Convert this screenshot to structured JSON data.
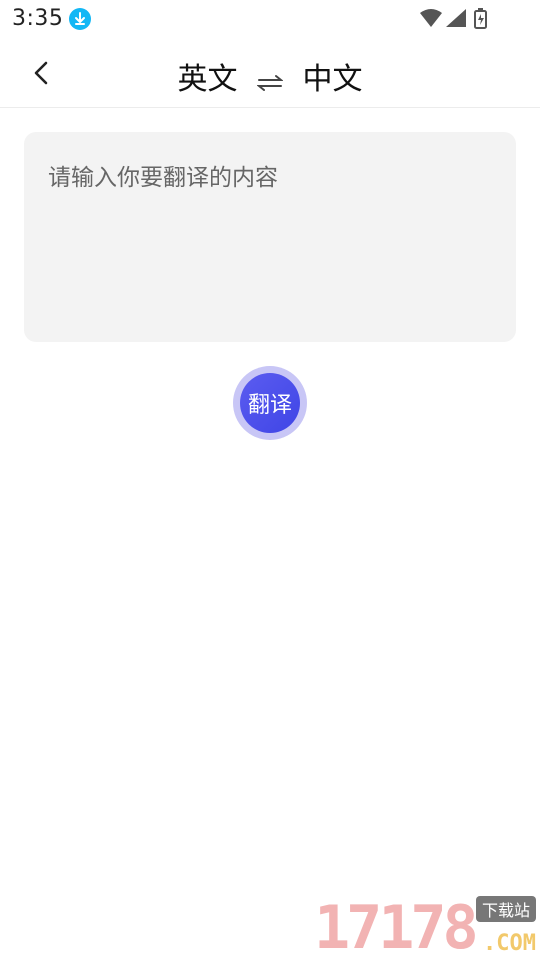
{
  "status_bar": {
    "time": "3:35"
  },
  "header": {
    "source_language": "英文",
    "target_language": "中文"
  },
  "input": {
    "placeholder": "请输入你要翻译的内容",
    "value": ""
  },
  "translate_button": {
    "label": "翻译"
  },
  "watermark": {
    "number": "17178",
    "tag": "下载站",
    "suffix": ".COM"
  },
  "colors": {
    "accent": "#4a4ce8",
    "accent_ring": "#c8c6f6",
    "download_badge": "#12b7f5",
    "input_bg": "#f3f3f3"
  },
  "icons": [
    "download-icon",
    "wifi-icon",
    "signal-icon",
    "battery-icon",
    "back-arrow-icon",
    "swap-arrows-icon"
  ]
}
